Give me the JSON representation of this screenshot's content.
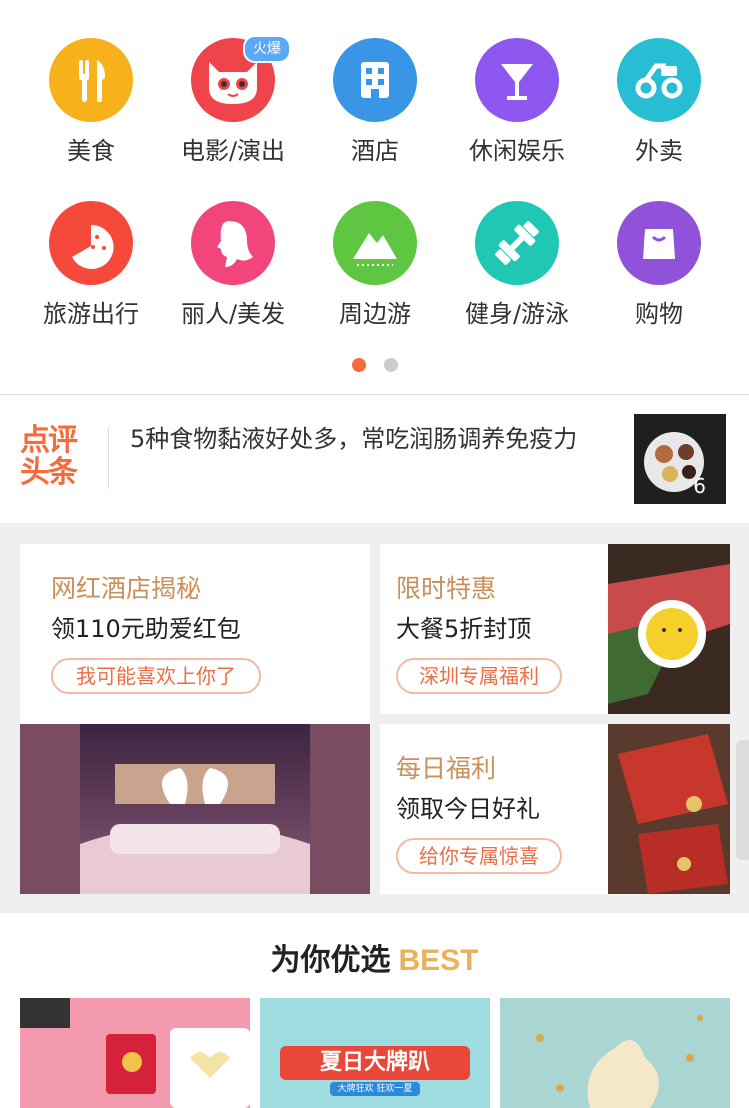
{
  "categories": [
    {
      "label": "美食",
      "icon": "fork-knife-icon",
      "color": "#f7b21b"
    },
    {
      "label": "电影/演出",
      "icon": "cat-icon",
      "color": "#f0444c"
    },
    {
      "label": "酒店",
      "icon": "hotel-building-icon",
      "color": "#3995e6"
    },
    {
      "label": "休闲娱乐",
      "icon": "cocktail-glass-icon",
      "color": "#8e58f0"
    },
    {
      "label": "外卖",
      "icon": "delivery-scooter-icon",
      "color": "#27bdd3"
    },
    {
      "label": "旅游出行",
      "icon": "watermelon-icon",
      "color": "#f4493b"
    },
    {
      "label": "丽人/美发",
      "icon": "woman-profile-icon",
      "color": "#f2457c"
    },
    {
      "label": "周边游",
      "icon": "mountain-icon",
      "color": "#5ec640"
    },
    {
      "label": "健身/游泳",
      "icon": "dumbbell-icon",
      "color": "#20c8b4"
    },
    {
      "label": "购物",
      "icon": "shopping-bag-icon",
      "color": "#9052d8"
    }
  ],
  "hot_badge": "火爆",
  "pager": {
    "active_color": "#f56c3a",
    "inactive_color": "#cccccc"
  },
  "headline": {
    "logo_line1": "点评",
    "logo_line2": "头条",
    "text": "5种食物黏液好处多，常吃润肠调养免疫力",
    "thumb_count": "6"
  },
  "promos": {
    "hotel": {
      "title": "网红酒店揭秘",
      "subtitle": "领110元助爱红包",
      "button": "我可能喜欢上你了"
    },
    "flash": {
      "title": "限时特惠",
      "subtitle": "大餐5折封顶",
      "button": "深圳专属福利"
    },
    "daily": {
      "title": "每日福利",
      "subtitle": "领取今日好礼",
      "button": "给你专属惊喜"
    }
  },
  "best": {
    "title": "为你优选",
    "title_en": "BEST",
    "banner2_text": "夏日大牌趴",
    "banner2_sub": "大牌狂欢 狂欢一夏"
  },
  "brand_color": "#f56c3a"
}
